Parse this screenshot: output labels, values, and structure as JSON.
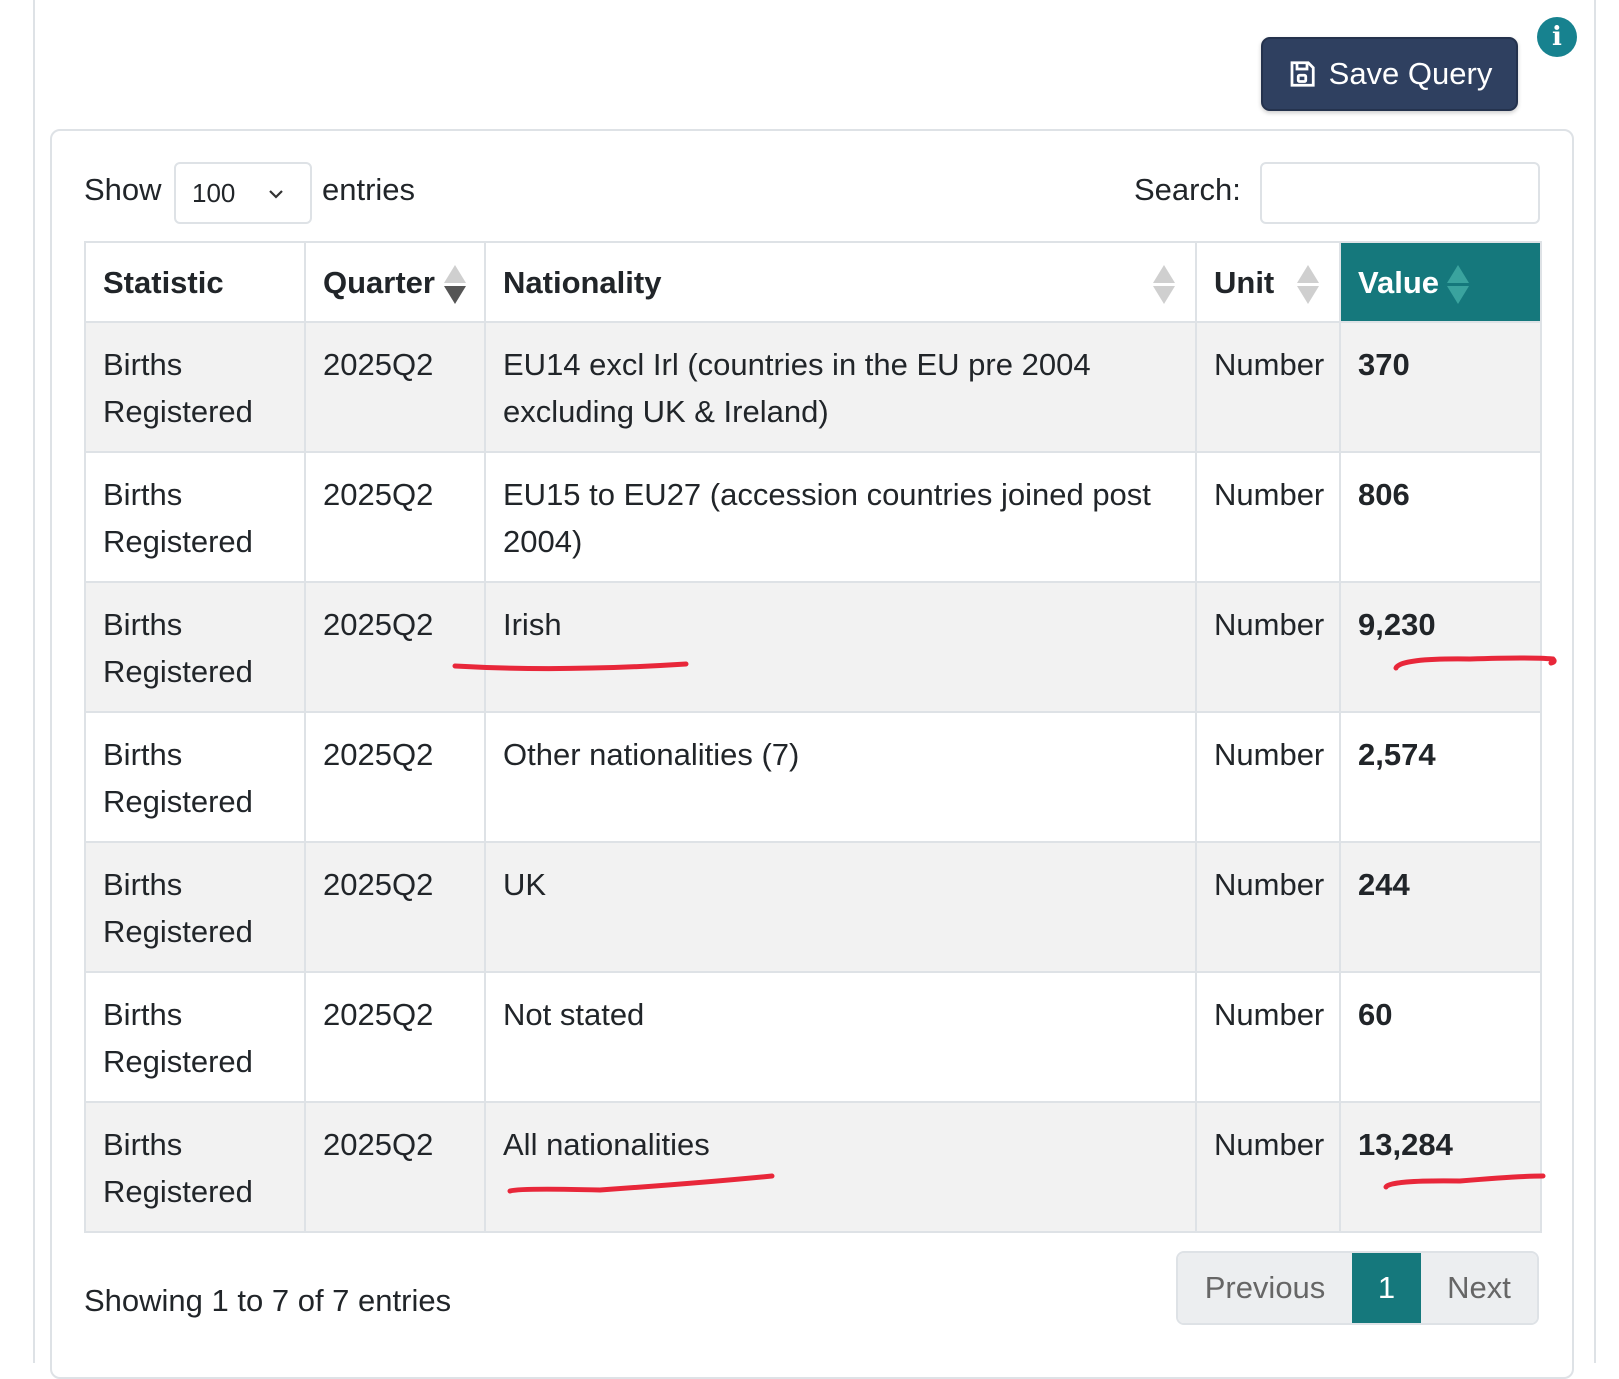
{
  "toolbar": {
    "save_label": "Save Query",
    "info_icon": "i"
  },
  "length": {
    "show_label": "Show",
    "selected": "100",
    "entries_label": "entries"
  },
  "search": {
    "label": "Search:",
    "value": ""
  },
  "table": {
    "headers": [
      "Statistic",
      "Quarter",
      "Nationality",
      "Unit",
      "Value"
    ],
    "rows": [
      {
        "statistic": "Births Registered",
        "quarter": "2025Q2",
        "nationality": "EU14 excl Irl (countries in the EU pre 2004 excluding UK & Ireland)",
        "unit": "Number",
        "value": "370"
      },
      {
        "statistic": "Births Registered",
        "quarter": "2025Q2",
        "nationality": "EU15 to EU27 (accession countries joined post 2004)",
        "unit": "Number",
        "value": "806"
      },
      {
        "statistic": "Births Registered",
        "quarter": "2025Q2",
        "nationality": "Irish",
        "unit": "Number",
        "value": "9,230"
      },
      {
        "statistic": "Births Registered",
        "quarter": "2025Q2",
        "nationality": "Other nationalities (7)",
        "unit": "Number",
        "value": "2,574"
      },
      {
        "statistic": "Births Registered",
        "quarter": "2025Q2",
        "nationality": "UK",
        "unit": "Number",
        "value": "244"
      },
      {
        "statistic": "Births Registered",
        "quarter": "2025Q2",
        "nationality": "Not stated",
        "unit": "Number",
        "value": "60"
      },
      {
        "statistic": "Births Registered",
        "quarter": "2025Q2",
        "nationality": "All nationalities",
        "unit": "Number",
        "value": "13,284"
      }
    ]
  },
  "footer": {
    "info": "Showing 1 to 7 of 7 entries",
    "previous": "Previous",
    "current_page": "1",
    "next": "Next"
  },
  "colors": {
    "accent": "#15787c",
    "save_button": "#2f4060",
    "annotation": "#e8273a"
  }
}
